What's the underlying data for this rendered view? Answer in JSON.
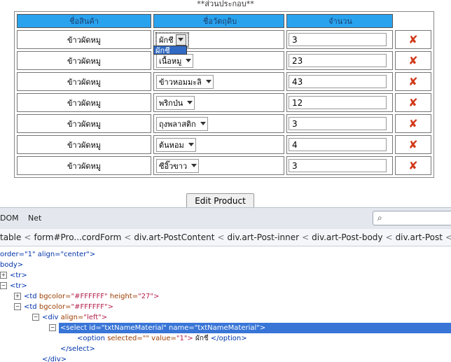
{
  "section_title": "**ส่วนประกอบ**",
  "table": {
    "headers": [
      "ชื่อสินค้า",
      "ชื่อวัตถุดิบ",
      "จำนวน"
    ],
    "rows": [
      {
        "product": "ข้าวผัดหมู",
        "material": "ผักชี",
        "qty": "3"
      },
      {
        "product": "ข้าวผัดหมู",
        "material": "เนื้อหมู",
        "qty": "23"
      },
      {
        "product": "ข้าวผัดหมู",
        "material": "ข้าวหอมมะลิ",
        "qty": "43"
      },
      {
        "product": "ข้าวผัดหมู",
        "material": "พริกป่น",
        "qty": "12"
      },
      {
        "product": "ข้าวผัดหมู",
        "material": "ถุงพลาสติก",
        "qty": "3"
      },
      {
        "product": "ข้าวผัดหมู",
        "material": "ต้นหอม",
        "qty": "4"
      },
      {
        "product": "ข้าวผัดหมู",
        "material": "ซีอิ๊วขาว",
        "qty": "3"
      }
    ],
    "delete_icon": "✘"
  },
  "dropdown_option": "ผักชี",
  "edit_button": "Edit Product",
  "devtools": {
    "tabs": [
      "DOM",
      "Net"
    ],
    "search_icon": "⌕",
    "breadcrumb": [
      "table",
      "form#Pro...cordForm",
      "div.art-PostContent",
      "div.art-Post-inner",
      "div.art-Post-body",
      "div.art-Post",
      "di"
    ],
    "breadcrumb_sep": "<",
    "tree": {
      "l1": "order=\"1\" align=\"center\">",
      "l2": "body>",
      "l3": "<tr>",
      "l4": "<tr>",
      "l5_tag": "<td",
      "l5_attr": "bgcolor=",
      "l5_val": "\"#FFFFFF\"",
      "l5_attr2": "height=",
      "l5_val2": "\"27\">",
      "l6_tag": "<td",
      "l6_attr": "bgcolor=",
      "l6_val": "\"#FFFFFF\">",
      "l7_tag": "<div",
      "l7_attr": "align=",
      "l7_val": "\"left\">",
      "l8": "<select id=\"txtNameMaterial\" name=\"txtNameMaterial\">",
      "l9_tag": "<option",
      "l9_attr": "selected=\"\" value=",
      "l9_val": "\"1\">",
      "l9_text": "ผักชี",
      "l9_end": "</option>",
      "l10": "</select>",
      "l11": "</div>",
      "toggle_plus": "+",
      "toggle_minus": "−"
    }
  }
}
